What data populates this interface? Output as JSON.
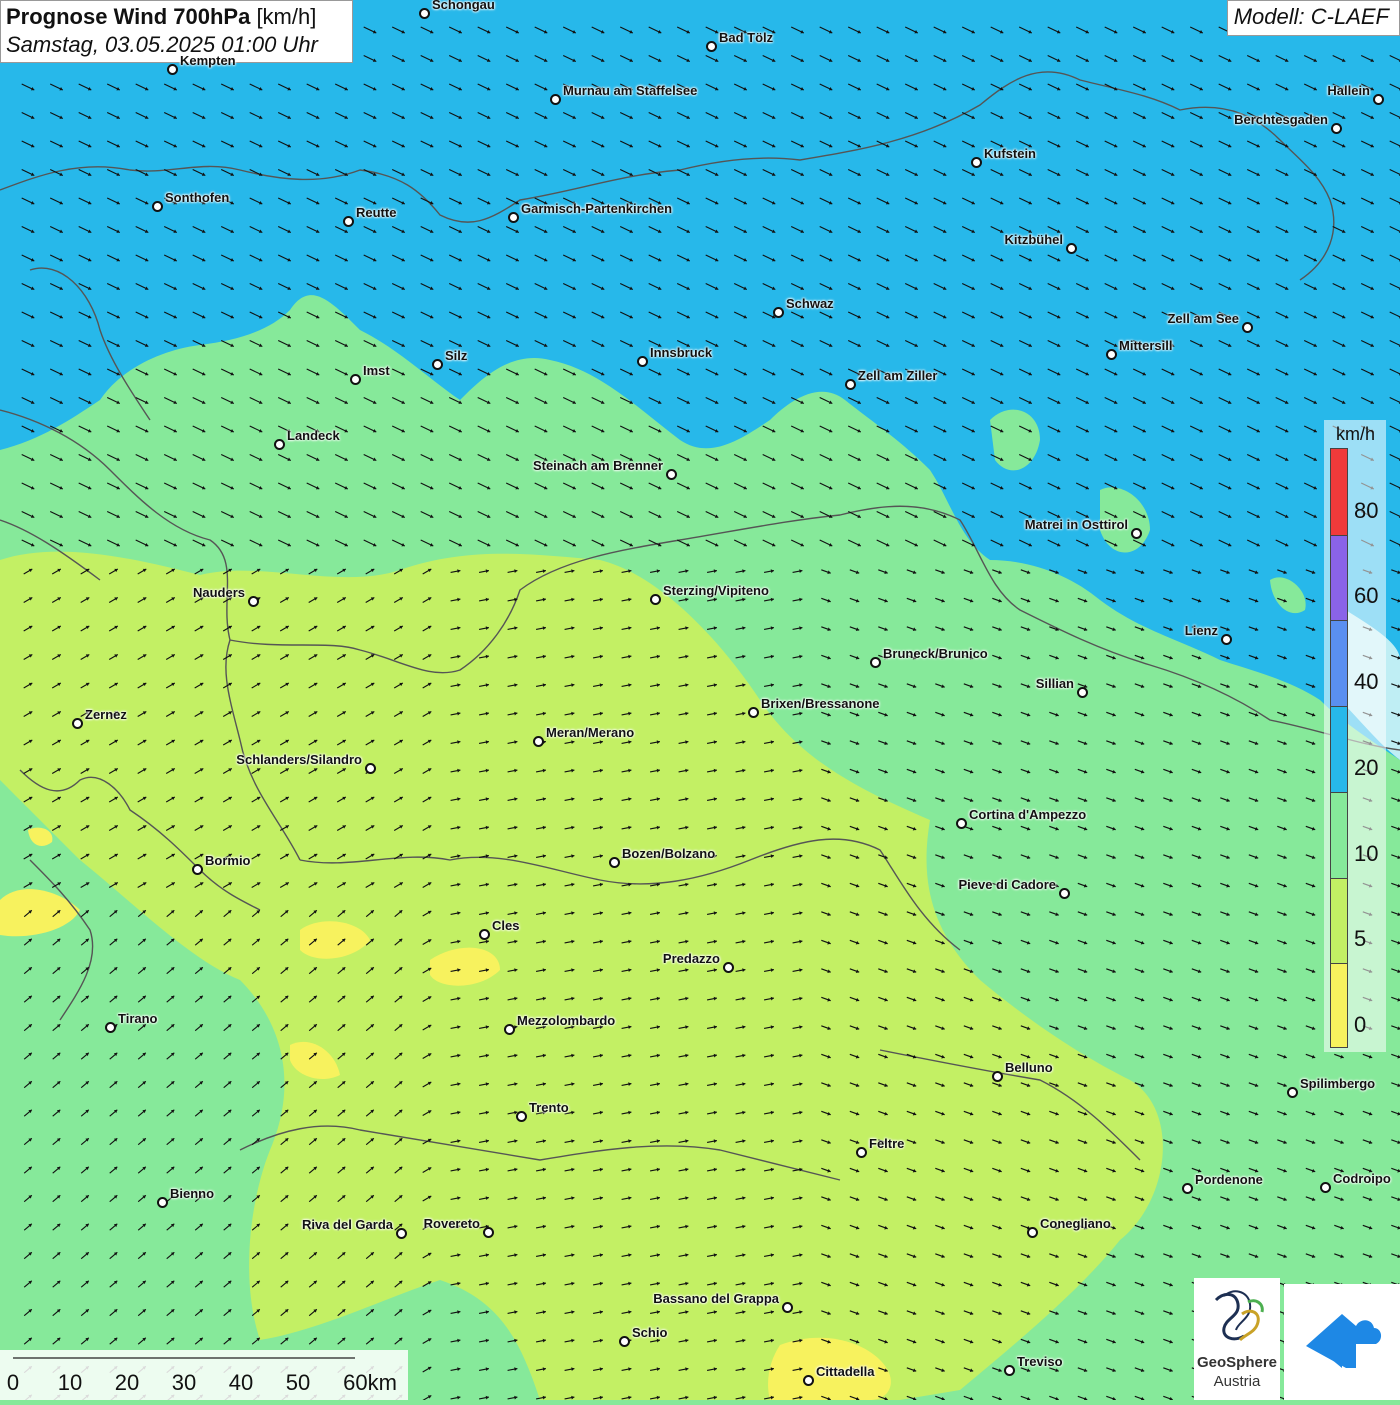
{
  "title": {
    "main": "Prognose Wind 700hPa",
    "unit": "[km/h]",
    "datetime": "Samstag, 03.05.2025 01:00 Uhr"
  },
  "model": "Modell: C-LAEF",
  "legend": {
    "unit": "km/h",
    "labels": [
      "80",
      "60",
      "40",
      "20",
      "10",
      "5",
      "0"
    ],
    "colors": [
      "#f03a3a",
      "#8a63e8",
      "#5a8ff0",
      "#27b8ea",
      "#86e99a",
      "#c3f064",
      "#f7f25e"
    ]
  },
  "scale": {
    "labels": [
      "0",
      "10",
      "20",
      "30",
      "40",
      "50",
      "60km"
    ]
  },
  "logos": {
    "geosphere_line1": "GeoSphere",
    "geosphere_line2": "Austria",
    "app_icon": "cloud-arrow-logo"
  },
  "colors": {
    "wind_fast": "#27b8ea",
    "wind_medium": "#86e99a",
    "wind_slow": "#c3f064",
    "wind_calm": "#f7f25e"
  },
  "cities": [
    {
      "name": "Schongau"
    },
    {
      "name": "Bad Tölz"
    },
    {
      "name": "Kempten"
    },
    {
      "name": "Murnau am Staffelsee"
    },
    {
      "name": "Hallein"
    },
    {
      "name": "Berchtesgaden"
    },
    {
      "name": "Kufstein"
    },
    {
      "name": "Sonthofen"
    },
    {
      "name": "Reutte"
    },
    {
      "name": "Garmisch-Partenkirchen"
    },
    {
      "name": "Kitzbühel"
    },
    {
      "name": "Schwaz"
    },
    {
      "name": "Zell am See"
    },
    {
      "name": "Mittersill"
    },
    {
      "name": "Silz"
    },
    {
      "name": "Innsbruck"
    },
    {
      "name": "Imst"
    },
    {
      "name": "Zell am Ziller"
    },
    {
      "name": "Landeck"
    },
    {
      "name": "Steinach am Brenner"
    },
    {
      "name": "Matrei in Osttirol"
    },
    {
      "name": "Nauders"
    },
    {
      "name": "Sterzing/Vipiteno"
    },
    {
      "name": "Lienz"
    },
    {
      "name": "Bruneck/Brunico"
    },
    {
      "name": "Sillian"
    },
    {
      "name": "Zernez"
    },
    {
      "name": "Brixen/Bressanone"
    },
    {
      "name": "Meran/Merano"
    },
    {
      "name": "Schlanders/Silandro"
    },
    {
      "name": "Cortina d'Ampezzo"
    },
    {
      "name": "Bozen/Bolzano"
    },
    {
      "name": "Bormio"
    },
    {
      "name": "Pieve di Cadore"
    },
    {
      "name": "Cles"
    },
    {
      "name": "Predazzo"
    },
    {
      "name": "Tirano"
    },
    {
      "name": "Mezzolombardo"
    },
    {
      "name": "Belluno"
    },
    {
      "name": "Spilimbergo"
    },
    {
      "name": "Trento"
    },
    {
      "name": "Feltre"
    },
    {
      "name": "Bienno"
    },
    {
      "name": "Pordenone"
    },
    {
      "name": "Codroipo"
    },
    {
      "name": "Riva del Garda"
    },
    {
      "name": "Rovereto"
    },
    {
      "name": "Conegliano"
    },
    {
      "name": "Bassano del Grappa"
    },
    {
      "name": "Schio"
    },
    {
      "name": "Treviso"
    },
    {
      "name": "Cittadella"
    }
  ]
}
